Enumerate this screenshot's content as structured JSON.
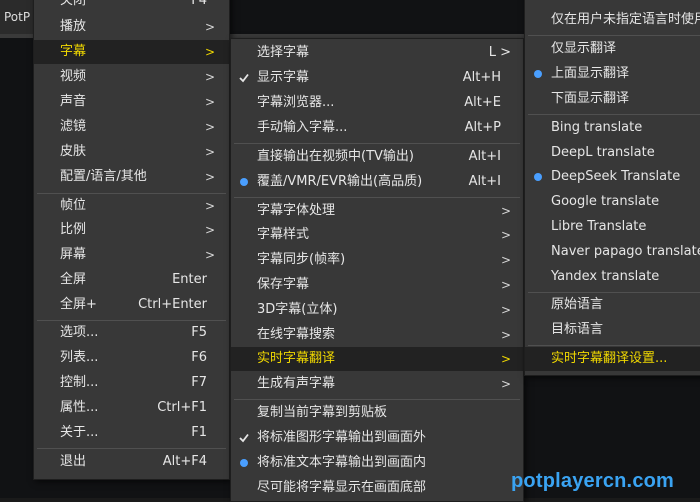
{
  "app": {
    "title_fragment": "PotP"
  },
  "menu1": {
    "items": [
      {
        "label": "关闭",
        "shortcut": "F4"
      },
      {
        "label": "播放"
      },
      {
        "label": "字幕"
      },
      {
        "label": "视频"
      },
      {
        "label": "声音"
      },
      {
        "label": "滤镜"
      },
      {
        "label": "皮肤"
      },
      {
        "label": "配置/语言/其他"
      },
      {
        "label": "帧位"
      },
      {
        "label": "比例"
      },
      {
        "label": "屏幕"
      },
      {
        "label": "全屏",
        "shortcut": "Enter"
      },
      {
        "label": "全屏+",
        "shortcut": "Ctrl+Enter"
      },
      {
        "label": "选项...",
        "shortcut": "F5"
      },
      {
        "label": "列表...",
        "shortcut": "F6"
      },
      {
        "label": "控制...",
        "shortcut": "F7"
      },
      {
        "label": "属性...",
        "shortcut": "Ctrl+F1"
      },
      {
        "label": "关于...",
        "shortcut": "F1"
      },
      {
        "label": "退出",
        "shortcut": "Alt+F4"
      }
    ],
    "arrow": ">"
  },
  "menu2": {
    "items": [
      {
        "label": "选择字幕",
        "shortcut": "L >"
      },
      {
        "label": "显示字幕",
        "shortcut": "Alt+H"
      },
      {
        "label": "字幕浏览器...",
        "shortcut": "Alt+E"
      },
      {
        "label": "手动输入字幕...",
        "shortcut": "Alt+P"
      },
      {
        "label": "直接输出在视频中(TV输出)",
        "shortcut": "Alt+I"
      },
      {
        "label": "覆盖/VMR/EVR输出(高品质)",
        "shortcut": "Alt+I"
      },
      {
        "label": "字幕字体处理"
      },
      {
        "label": "字幕样式"
      },
      {
        "label": "字幕同步(帧率)"
      },
      {
        "label": "保存字幕"
      },
      {
        "label": "3D字幕(立体)"
      },
      {
        "label": "在线字幕搜索"
      },
      {
        "label": "实时字幕翻译"
      },
      {
        "label": "生成有声字幕"
      },
      {
        "label": "复制当前字幕到剪贴板"
      },
      {
        "label": "将标准图形字幕输出到画面外"
      },
      {
        "label": "将标准文本字幕输出到画面内"
      },
      {
        "label": "尽可能将字幕显示在画面底部"
      }
    ],
    "arrow": ">"
  },
  "menu3": {
    "items": [
      {
        "label": "仅在用户未指定语言时使用"
      },
      {
        "label": "仅显示翻译"
      },
      {
        "label": "上面显示翻译"
      },
      {
        "label": "下面显示翻译"
      },
      {
        "label": "Bing translate"
      },
      {
        "label": "DeepL translate"
      },
      {
        "label": "DeepSeek Translate"
      },
      {
        "label": "Google translate"
      },
      {
        "label": "Libre Translate"
      },
      {
        "label": "Naver papago translate("
      },
      {
        "label": "Yandex translate"
      },
      {
        "label": "原始语言"
      },
      {
        "label": "目标语言"
      },
      {
        "label": "实时字幕翻译设置..."
      }
    ]
  },
  "watermark": "potplayercn.com",
  "colors": {
    "highlight_text": "#f0d800",
    "radio_dot": "#4a9fff",
    "menu_bg": "#383838"
  },
  "icons": {
    "check": "check-icon",
    "radio": "radio-dot-icon",
    "submenu": "chevron-right-icon"
  }
}
